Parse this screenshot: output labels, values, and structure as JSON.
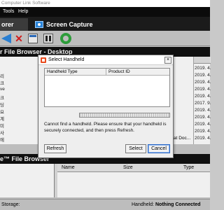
{
  "window": {
    "title": "Computer Link Software"
  },
  "menu": {
    "tools": "Tools",
    "help": "Help"
  },
  "tabs": {
    "explorer": "orer",
    "screen_capture": "Screen Capture"
  },
  "toolbar": {
    "icons": [
      "back-icon",
      "delete-icon",
      "properties-icon",
      "columns-icon",
      "refresh-icon"
    ]
  },
  "desktop_panel": {
    "title": "r File Browser - Desktop",
    "tree_items": [
      "리",
      "크",
      "ve",
      "크",
      "딩",
      "요",
      "계",
      "미",
      "사",
      "에"
    ],
    "dates": [
      "2019. 4.",
      "2019. 4.",
      "2019. 4.",
      "2019. 4.",
      "2019. 4.",
      "2017. 9.",
      "2019. 4.",
      "2019. 4.",
      "2019. 4.",
      "2019. 4.",
      "2019. 4.",
      "2019. 4."
    ],
    "type_fragment": "at Doc..."
  },
  "dialog": {
    "title": "Select Handheld",
    "columns": [
      "Handheld Type",
      "Product ID"
    ],
    "message": "Cannot find a handheld. Please ensure that your handheld is securely connected, and then press Refresh.",
    "buttons": {
      "refresh": "Refresh",
      "select": "Select",
      "cancel": "Cancel"
    }
  },
  "handheld_panel": {
    "title": "e™ File Browser",
    "columns": [
      "Name",
      "Size",
      "Type"
    ]
  },
  "status": {
    "storage_label": "Storage:",
    "handheld_label": "Handheld:",
    "handheld_value": "Nothing Connected"
  }
}
